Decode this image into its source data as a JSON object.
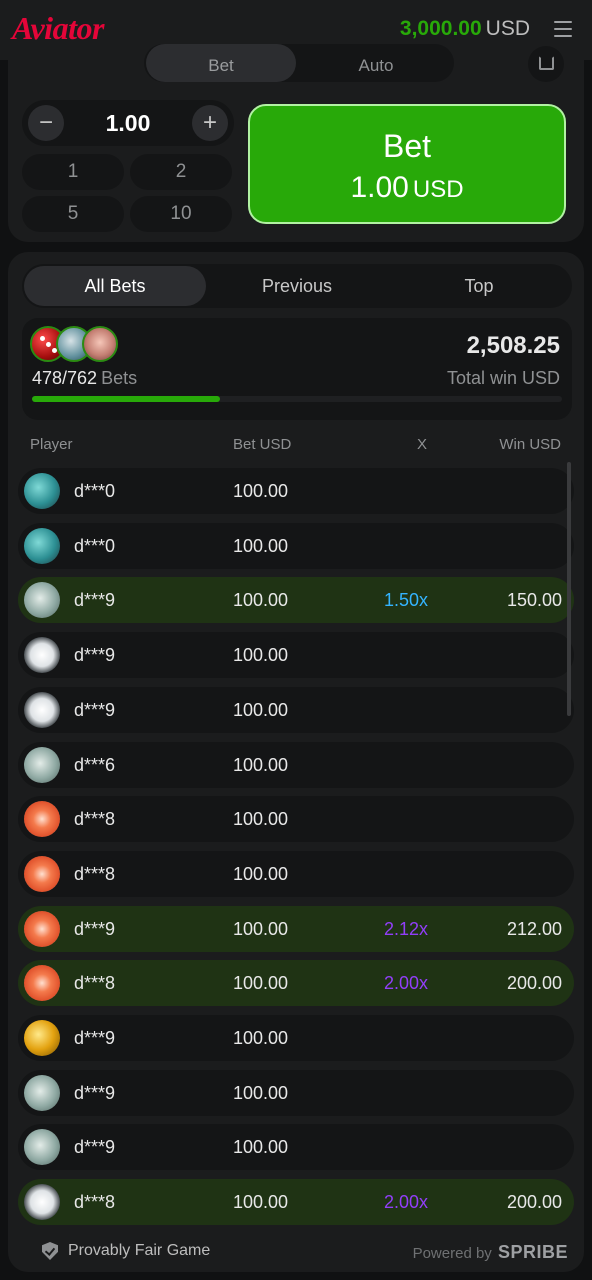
{
  "header": {
    "logo": "Aviator",
    "balance_amount": "3,000.00",
    "balance_currency": "USD"
  },
  "bet_panel": {
    "mode_tabs": [
      "Bet",
      "Auto"
    ],
    "stake_value": "1.00",
    "quick_amounts": [
      "1",
      "2",
      "5",
      "10"
    ],
    "bet_button_label": "Bet",
    "bet_button_amount": "1.00",
    "bet_button_currency": "USD"
  },
  "bets": {
    "tabs": [
      "All Bets",
      "Previous",
      "Top"
    ],
    "active_tab": "All Bets",
    "bets_count": "478/762",
    "bets_label": "Bets",
    "total_win": "2,508.25",
    "total_win_label": "Total win USD",
    "progress_fraction": 0.354,
    "columns": {
      "player": "Player",
      "bet": "Bet USD",
      "x": "X",
      "win": "Win USD"
    },
    "rows": [
      {
        "player": "d***0",
        "bet": "100.00",
        "mult": "",
        "win": "",
        "avatar": "sneaker-icon",
        "won": false
      },
      {
        "player": "d***0",
        "bet": "100.00",
        "mult": "",
        "win": "",
        "avatar": "sneaker-icon",
        "won": false
      },
      {
        "player": "d***9",
        "bet": "100.00",
        "mult": "1.50x",
        "win": "150.00",
        "avatar": "cash-icon",
        "won": true,
        "mult_color": "#34b4ff"
      },
      {
        "player": "d***9",
        "bet": "100.00",
        "mult": "",
        "win": "",
        "avatar": "toilet-paper-icon",
        "won": false
      },
      {
        "player": "d***9",
        "bet": "100.00",
        "mult": "",
        "win": "",
        "avatar": "toilet-paper-icon",
        "won": false
      },
      {
        "player": "d***6",
        "bet": "100.00",
        "mult": "",
        "win": "",
        "avatar": "cash-icon",
        "won": false
      },
      {
        "player": "d***8",
        "bet": "100.00",
        "mult": "",
        "win": "",
        "avatar": "grapefruit-icon",
        "won": false
      },
      {
        "player": "d***8",
        "bet": "100.00",
        "mult": "",
        "win": "",
        "avatar": "grapefruit-icon",
        "won": false
      },
      {
        "player": "d***9",
        "bet": "100.00",
        "mult": "2.12x",
        "win": "212.00",
        "avatar": "grapefruit-icon",
        "won": true,
        "mult_color": "#913ef8"
      },
      {
        "player": "d***8",
        "bet": "100.00",
        "mult": "2.00x",
        "win": "200.00",
        "avatar": "grapefruit-icon",
        "won": true,
        "mult_color": "#913ef8"
      },
      {
        "player": "d***9",
        "bet": "100.00",
        "mult": "",
        "win": "",
        "avatar": "gold-gem-icon",
        "won": false
      },
      {
        "player": "d***9",
        "bet": "100.00",
        "mult": "",
        "win": "",
        "avatar": "cash-icon",
        "won": false
      },
      {
        "player": "d***9",
        "bet": "100.00",
        "mult": "",
        "win": "",
        "avatar": "cash-icon",
        "won": false
      },
      {
        "player": "d***8",
        "bet": "100.00",
        "mult": "2.00x",
        "win": "200.00",
        "avatar": "toilet-paper-icon",
        "won": true,
        "mult_color": "#913ef8"
      }
    ]
  },
  "footer": {
    "fair_label": "Provably Fair Game",
    "powered_label": "Powered by",
    "powered_brand": "SPRIBE"
  },
  "colors": {
    "accent_green": "#28a909",
    "brand_red": "#e50539",
    "panel": "#1b1c1d",
    "win_row": "#1f3314"
  }
}
